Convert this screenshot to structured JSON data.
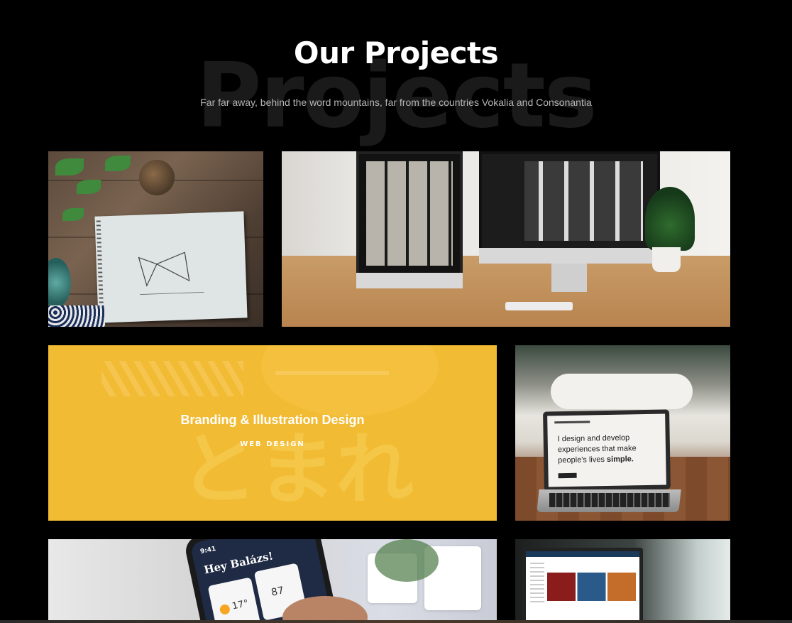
{
  "section": {
    "background_word": "Projects",
    "title": "Our Projects",
    "subtitle": "Far far away, behind the word mountains, far from the countries Vokalia and Consonantia"
  },
  "projects": [
    {
      "image": "sketchbook-butterfly-photo"
    },
    {
      "image": "desk-monitors-photo"
    },
    {
      "image": "yellow-branding-illustration",
      "title": "Branding & Illustration Design",
      "category": "WEB DESIGN",
      "accent": "#f2bb34"
    },
    {
      "image": "laptop-design-quote-photo",
      "screen_text_1": "I design and develop experiences that make people's lives ",
      "screen_text_2": "simple."
    },
    {
      "image": "phone-weather-app-photo",
      "phone_time": "9:41",
      "greeting": "Hey Balázs!",
      "weather_temp": "17°",
      "air_quality": "87"
    },
    {
      "image": "laptop-website-photo"
    }
  ],
  "colors": {
    "background": "#000000",
    "title": "#ffffff",
    "subtitle": "#b5b5b5",
    "background_word": "#1a1a1a"
  }
}
